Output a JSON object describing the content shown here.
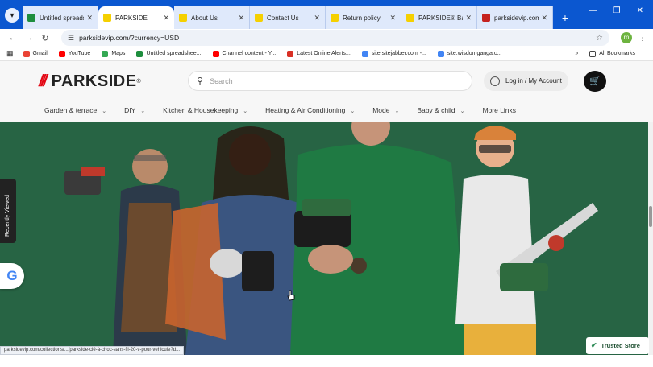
{
  "browser": {
    "tabs": [
      {
        "label": "Untitled spreads",
        "color": "#1e8e3e",
        "active": false
      },
      {
        "label": "PARKSIDE",
        "color": "#f5d000",
        "active": true
      },
      {
        "label": "About Us",
        "color": "#f5d000",
        "active": false
      },
      {
        "label": "Contact Us",
        "color": "#f5d000",
        "active": false
      },
      {
        "label": "Return policy",
        "color": "#f5d000",
        "active": false
      },
      {
        "label": "PARKSIDE® Batt",
        "color": "#f5d000",
        "active": false
      },
      {
        "label": "parksidevip.com",
        "color": "#c5221f",
        "active": false
      }
    ],
    "url": "parksidevip.com/?currency=USD",
    "bookmarks": [
      {
        "label": "Gmail",
        "color": "#ea4335"
      },
      {
        "label": "YouTube",
        "color": "#ff0000"
      },
      {
        "label": "Maps",
        "color": "#34a853"
      },
      {
        "label": "Untitled spreadshee...",
        "color": "#1e8e3e"
      },
      {
        "label": "Channel content - Y...",
        "color": "#ff0000"
      },
      {
        "label": "Latest Online Alerts...",
        "color": "#d93025"
      },
      {
        "label": "site:sitejabber.com -...",
        "color": "#4285f4"
      },
      {
        "label": "site:wisdomganga.c...",
        "color": "#4285f4"
      }
    ],
    "all_bookmarks": "All Bookmarks",
    "profile_initial": "m",
    "status_url": "parksidevip.com/collections/.../parkside-clé-à-choc-sans-fil-20-v-pour-vehicule?d..."
  },
  "site": {
    "logo": "PARKSIDE",
    "search_placeholder": "Search",
    "login": "Log in / My Account",
    "nav": [
      {
        "label": "Garden & terrace",
        "chevron": true
      },
      {
        "label": "DIY",
        "chevron": true
      },
      {
        "label": "Kitchen & Housekeeping",
        "chevron": true
      },
      {
        "label": "Heating & Air Conditioning",
        "chevron": true
      },
      {
        "label": "Mode",
        "chevron": true
      },
      {
        "label": "Baby & child",
        "chevron": true
      },
      {
        "label": "More Links",
        "chevron": false
      }
    ],
    "recently_viewed": "Recently Viewed",
    "trusted_store": "Trusted Store",
    "hero_bg": "#2a6a4a"
  }
}
